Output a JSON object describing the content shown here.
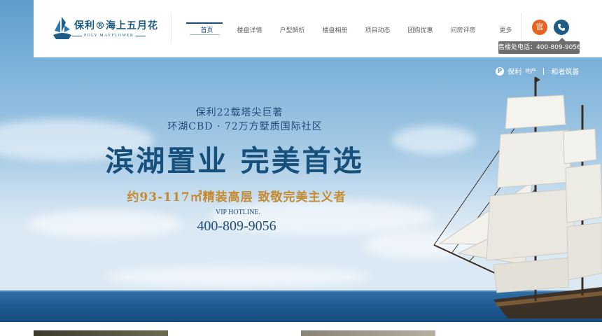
{
  "header": {
    "logo": {
      "name_cn": "保利®海上五月花",
      "name_en": "POLY MAYFLOWER"
    },
    "nav": [
      {
        "label": "首页",
        "active": true
      },
      {
        "label": "楼盘详情",
        "active": false
      },
      {
        "label": "户型解析",
        "active": false
      },
      {
        "label": "楼盘相册",
        "active": false
      },
      {
        "label": "项目动态",
        "active": false
      },
      {
        "label": "团购优惠",
        "active": false
      },
      {
        "label": "问房评房",
        "active": false
      },
      {
        "label": "更多",
        "active": false
      }
    ],
    "official_button_label": "官",
    "phone_icon": "phone-icon",
    "tooltip": "售楼处电话：400-809-9056"
  },
  "hero": {
    "brand": {
      "p_mark": "P",
      "poly_label": "保利",
      "estate_label": "地产",
      "slogan": "和者筑善"
    },
    "line1": "保利22载塔尖巨著",
    "line2": "环湖CBD · 72万方墅质国际社区",
    "headline": "滨湖置业 完美首选",
    "subline": "约93-117㎡精装高层 致敬完美主义者",
    "hotline_label": "VIP HOTLINE.",
    "hotline": "400-809-9056"
  },
  "colors": {
    "primary": "#1c5c86",
    "accent_orange": "#e8611f",
    "gold": "#c48a2f",
    "tooltip_bg": "#6e6e6e"
  }
}
